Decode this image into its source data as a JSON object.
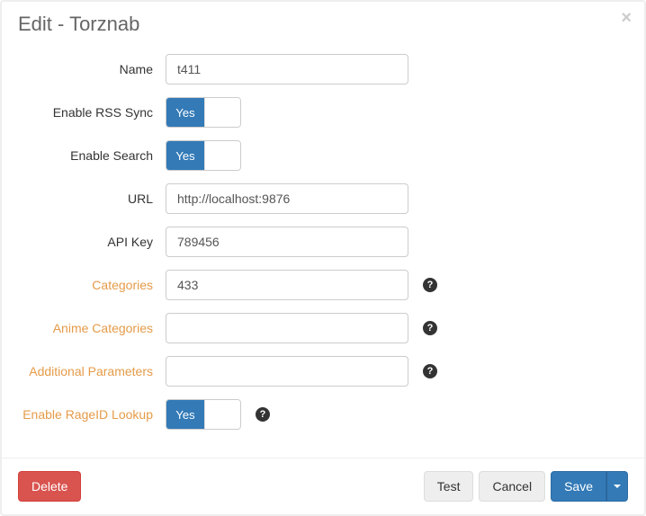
{
  "header": {
    "title": "Edit - Torznab"
  },
  "toggle": {
    "yes": "Yes"
  },
  "fields": {
    "name": {
      "label": "Name",
      "value": "t411",
      "advanced": false,
      "type": "text",
      "help": false
    },
    "enableRss": {
      "label": "Enable RSS Sync",
      "value": true,
      "advanced": false,
      "type": "toggle",
      "help": false
    },
    "enableSearch": {
      "label": "Enable Search",
      "value": true,
      "advanced": false,
      "type": "toggle",
      "help": false
    },
    "url": {
      "label": "URL",
      "value": "http://localhost:9876",
      "advanced": false,
      "type": "text",
      "help": false
    },
    "apiKey": {
      "label": "API Key",
      "value": "789456",
      "advanced": false,
      "type": "text",
      "help": false
    },
    "categories": {
      "label": "Categories",
      "value": "433",
      "advanced": true,
      "type": "text",
      "help": true
    },
    "animeCategories": {
      "label": "Anime Categories",
      "value": "",
      "advanced": true,
      "type": "text",
      "help": true
    },
    "additionalParams": {
      "label": "Additional Parameters",
      "value": "",
      "advanced": true,
      "type": "text",
      "help": true
    },
    "enableRageId": {
      "label": "Enable RageID Lookup",
      "value": true,
      "advanced": true,
      "type": "toggle",
      "help": true
    }
  },
  "footer": {
    "delete": "Delete",
    "test": "Test",
    "cancel": "Cancel",
    "save": "Save"
  }
}
